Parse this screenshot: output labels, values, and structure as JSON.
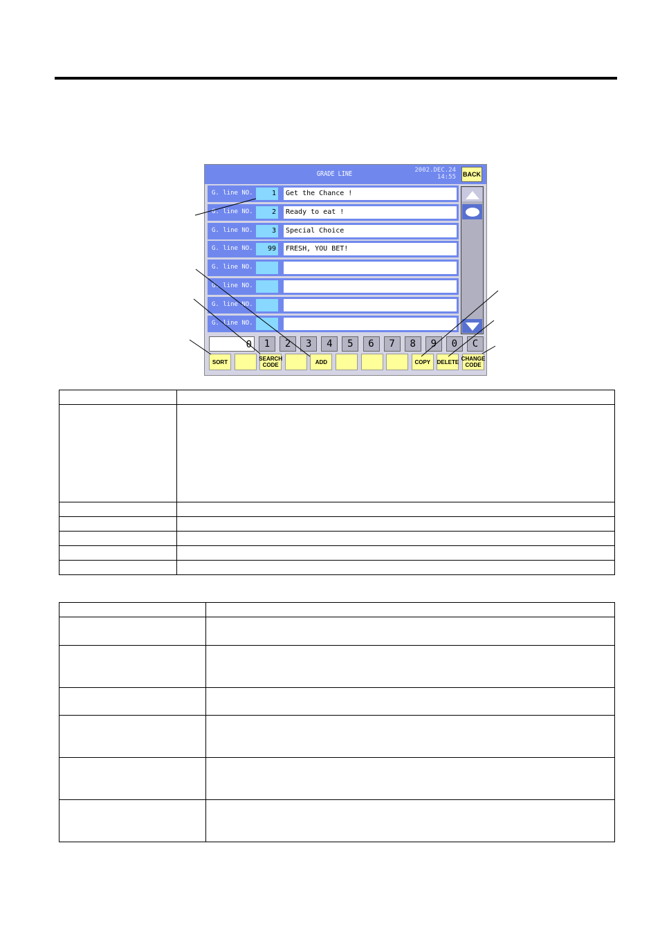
{
  "screen": {
    "title": "GRADE LINE",
    "date": "2002.DEC.24",
    "time": "14:55",
    "back_label": "BACK",
    "rows": [
      {
        "label": "G. line NO.",
        "number": "1",
        "text": "Get the Chance !"
      },
      {
        "label": "G. line NO.",
        "number": "2",
        "text": "Ready to eat !"
      },
      {
        "label": "G. line NO.",
        "number": "3",
        "text": "Special Choice"
      },
      {
        "label": "G. line NO.",
        "number": "99",
        "text": "FRESH, YOU BET!"
      },
      {
        "label": "G. line NO.",
        "number": "",
        "text": ""
      },
      {
        "label": "G. line NO.",
        "number": "",
        "text": ""
      },
      {
        "label": "G. line NO.",
        "number": "",
        "text": ""
      },
      {
        "label": "G. line NO.",
        "number": "",
        "text": ""
      }
    ],
    "numeric_display": "0",
    "keypad": [
      "1",
      "2",
      "3",
      "4",
      "5",
      "6",
      "7",
      "8",
      "9",
      "0",
      "C"
    ],
    "function_keys": [
      "SORT",
      "",
      "SEARCH\nCODE",
      "",
      "ADD",
      "",
      "",
      "",
      "COPY",
      "DELETE",
      "CHANGE\nCODE"
    ]
  },
  "table1": {
    "rows": 7
  },
  "table2": {
    "rows": 7
  }
}
